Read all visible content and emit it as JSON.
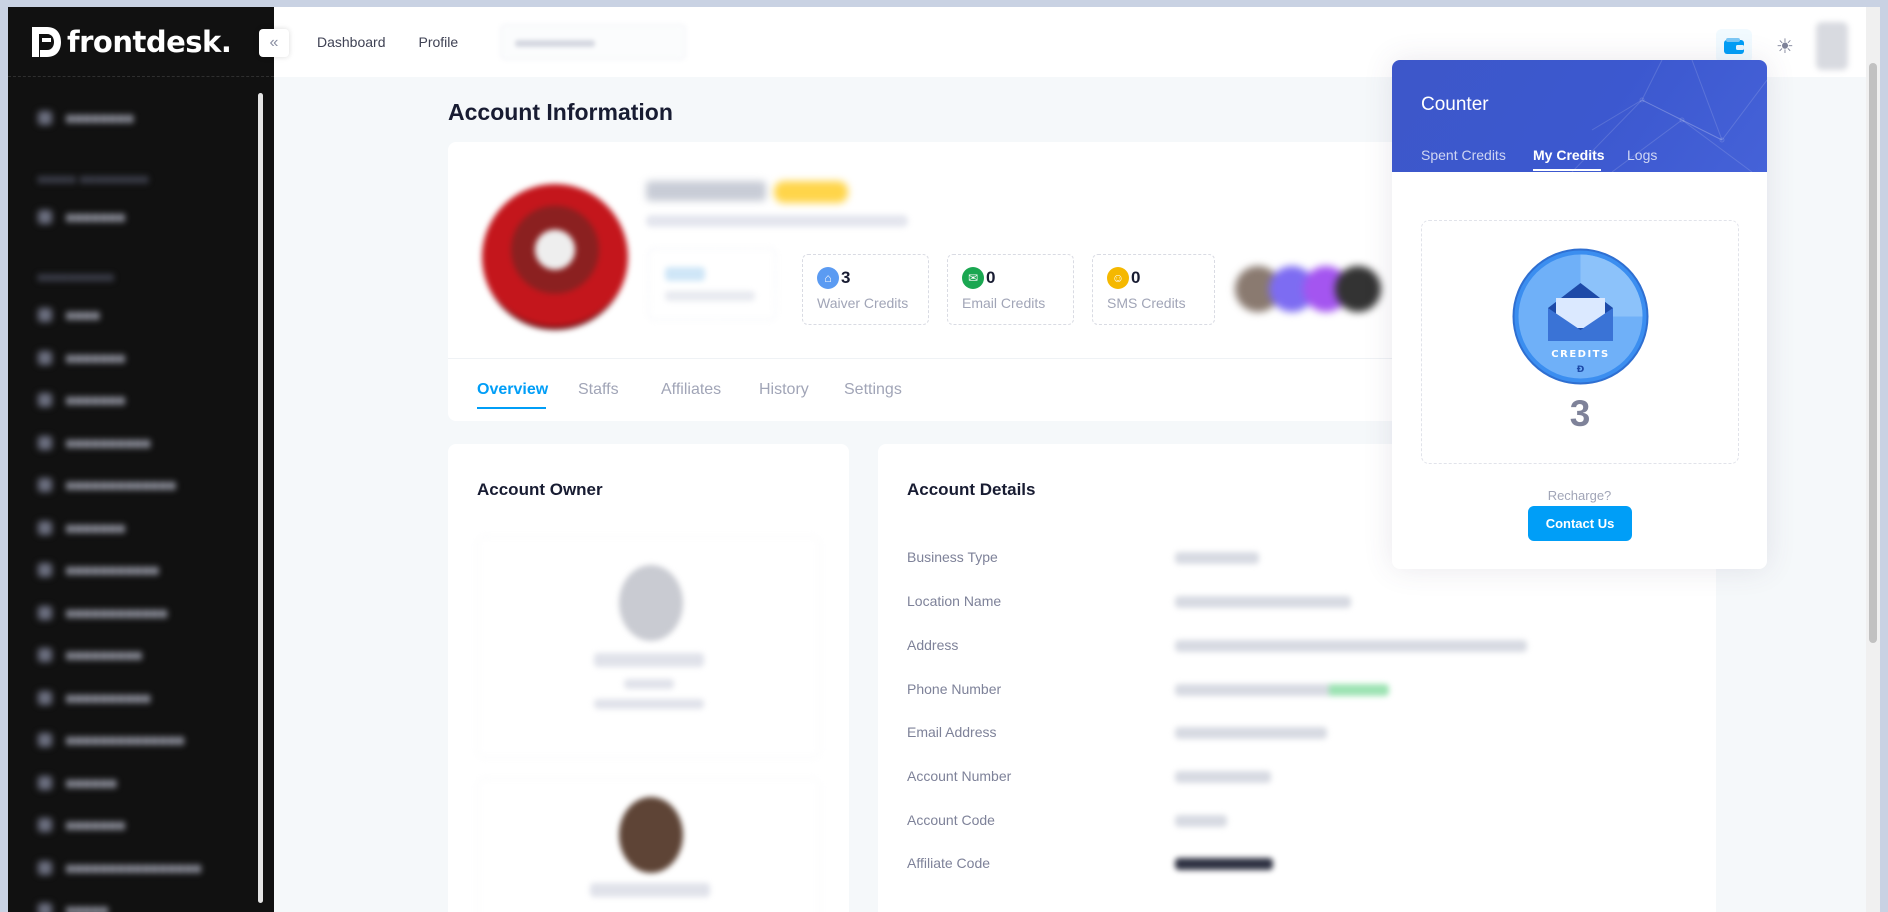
{
  "brand": {
    "name": "frontdesk."
  },
  "topbar": {
    "nav": [
      "Dashboard",
      "Profile"
    ]
  },
  "page": {
    "title": "Account Information"
  },
  "profile": {
    "stats": [
      {
        "value": "3",
        "label": "Waiver Credits",
        "color": "#5b9bf2",
        "icon": "house-icon"
      },
      {
        "value": "0",
        "label": "Email Credits",
        "color": "#1aa751",
        "icon": "envelope-icon"
      },
      {
        "value": "0",
        "label": "SMS Credits",
        "color": "#f5b800",
        "icon": "chat-icon"
      }
    ],
    "tabs": [
      "Overview",
      "Staffs",
      "Affiliates",
      "History",
      "Settings"
    ],
    "active_tab": "Overview"
  },
  "owner": {
    "title": "Account Owner"
  },
  "details": {
    "title": "Account Details",
    "rows": [
      "Business Type",
      "Location Name",
      "Address",
      "Phone Number",
      "Email Address",
      "Account Number",
      "Account Code",
      "Affiliate Code"
    ]
  },
  "counter": {
    "title": "Counter",
    "tabs": [
      "Spent Credits",
      "My Credits",
      "Logs"
    ],
    "active_tab": "My Credits",
    "badge_text": "CREDITS",
    "count": "3",
    "recharge_text": "Recharge?",
    "contact_label": "Contact Us"
  },
  "colors": {
    "accent": "#009ef7",
    "counter_header": "#3d57c9",
    "sidebar": "#111111"
  }
}
